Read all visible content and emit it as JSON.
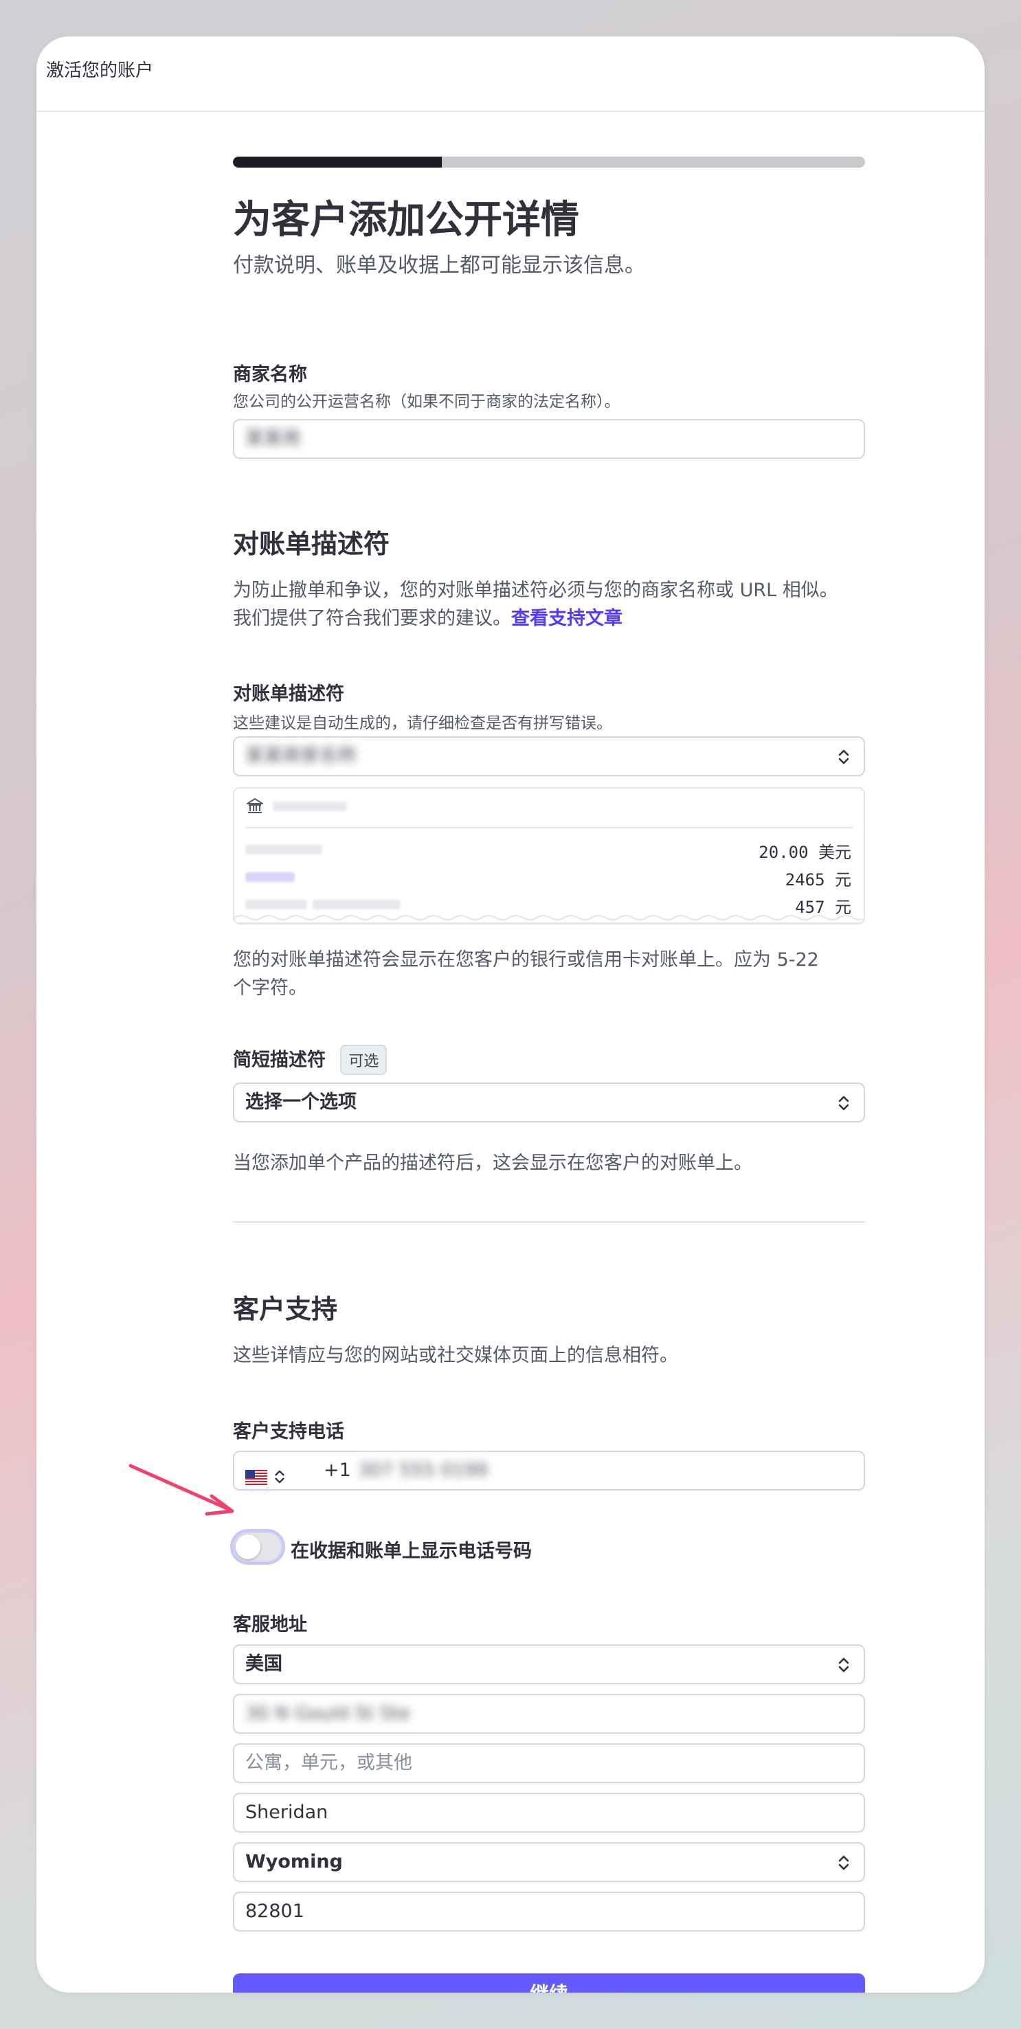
{
  "window": {
    "title": "激活您的账户"
  },
  "progress": {
    "fraction": 0.33
  },
  "page": {
    "title": "为客户添加公开详情",
    "subtitle": "付款说明、账单及收据上都可能显示该信息。"
  },
  "business_name": {
    "label": "商家名称",
    "hint": "您公司的公开运营名称（如果不同于商家的法定名称）。",
    "value": "某某商"
  },
  "statement_section": {
    "heading": "对账单描述符",
    "desc_line1": "为防止撤单和争议，您的对账单描述符必须与您的商家名称或 URL 相似。",
    "desc_line2": "我们提供了符合我们要求的建议。",
    "link": "查看支持文章"
  },
  "statement_descriptor": {
    "label": "对账单描述符",
    "hint": "这些建议是自动生成的，请仔细检查是否有拼写错误。",
    "value": "某某商家名称",
    "preview": {
      "icon": "bank-icon",
      "rows": [
        {
          "amount": "20.00 美元"
        },
        {
          "amount": "2465 元"
        },
        {
          "amount": "457 元"
        }
      ]
    },
    "footnote_line1": "您的对账单描述符会显示在您客户的银行或信用卡对账单上。应为 5-22",
    "footnote_line2": "个字符。"
  },
  "short_descriptor": {
    "label": "简短描述符",
    "badge": "可选",
    "value": "选择一个选项",
    "footnote": "当您添加单个产品的描述符后，这会显示在您客户的对账单上。"
  },
  "support_section": {
    "heading": "客户支持",
    "desc": "这些详情应与您的网站或社交媒体页面上的信息相符。"
  },
  "support_phone": {
    "label": "客户支持电话",
    "flag": "us-flag-icon",
    "country_code": "+1",
    "number": "307 555 0199"
  },
  "show_phone_toggle": {
    "label": "在收据和账单上显示电话号码",
    "on": false
  },
  "support_address": {
    "label": "客服地址",
    "country": "美国",
    "line1": "30 N Gould St Ste",
    "line2_placeholder": "公寓，单元，或其他",
    "city": "Sheridan",
    "state": "Wyoming",
    "zip": "82801"
  },
  "continue_button": {
    "label": "继续"
  },
  "colors": {
    "accent": "#635bff",
    "link": "#533afd",
    "arrow": "#f0436b"
  }
}
